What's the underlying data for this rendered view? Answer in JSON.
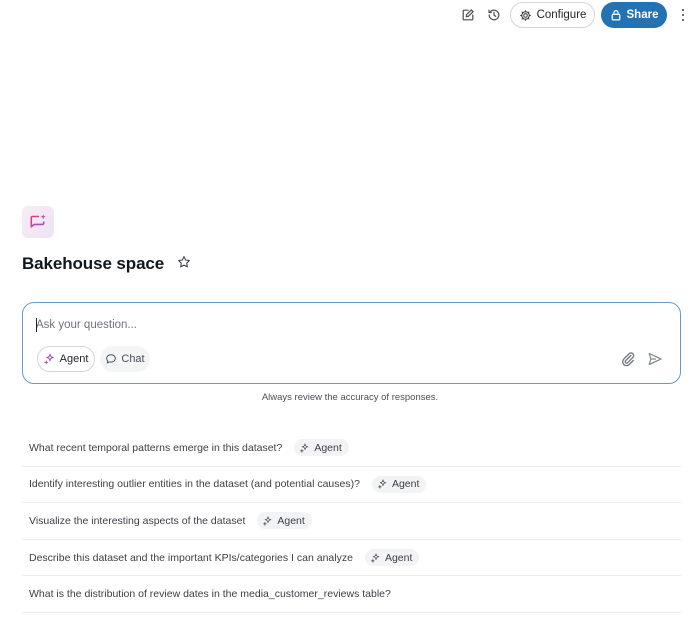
{
  "toolbar": {
    "edit_icon": "pencil-square-icon",
    "history_icon": "history-icon",
    "configure_label": "Configure",
    "configure_icon": "gear-icon",
    "share_label": "Share",
    "share_icon": "lock-icon",
    "more_icon": "kebab-menu-icon",
    "share_color": "#2272b4"
  },
  "space": {
    "logo_icon": "sparkle-frame-icon",
    "title": "Bakehouse space",
    "favorite_icon": "star-outline-icon"
  },
  "ask": {
    "placeholder": "Ask your question...",
    "modes": [
      {
        "label": "Agent",
        "icon": "agent-sparkle-icon",
        "selected": true
      },
      {
        "label": "Chat",
        "icon": "chat-bubble-icon",
        "selected": false
      }
    ],
    "attach_icon": "paperclip-icon",
    "send_icon": "send-icon",
    "border_color": "#6d97c7"
  },
  "disclaimer": "Always review the accuracy of responses.",
  "suggestions": [
    {
      "text": "What recent temporal patterns emerge in this dataset?",
      "chip": "Agent"
    },
    {
      "text": "Identify interesting outlier entities in the dataset (and potential causes)?",
      "chip": "Agent"
    },
    {
      "text": "Visualize the interesting aspects of the dataset",
      "chip": "Agent"
    },
    {
      "text": "Describe this dataset and the important KPIs/categories I can analyze",
      "chip": "Agent"
    },
    {
      "text": "What is the distribution of review dates in the media_customer_reviews table?",
      "chip": ""
    }
  ]
}
